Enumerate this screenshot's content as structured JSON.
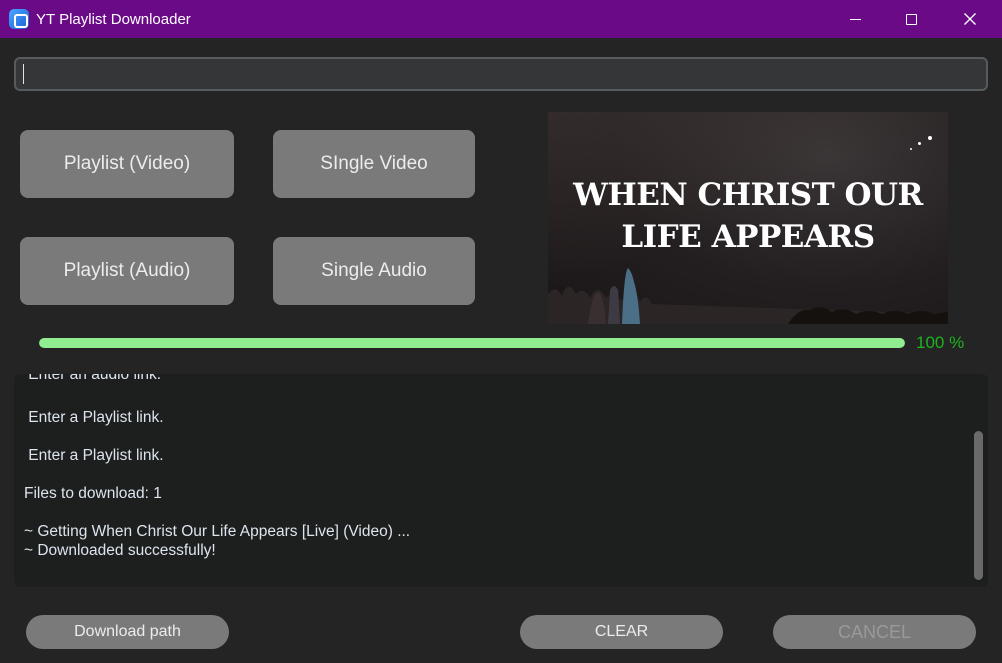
{
  "window": {
    "title": "YT Playlist Downloader",
    "titlebar_color": "#6b0a87"
  },
  "url_input": {
    "value": "",
    "placeholder": ""
  },
  "buttons": {
    "playlist_video": "Playlist (Video)",
    "single_video": "SIngle Video",
    "playlist_audio": "Playlist (Audio)",
    "single_audio": "Single Audio",
    "download_path": "Download path",
    "clear": "CLEAR",
    "cancel": "CANCEL"
  },
  "thumbnail": {
    "title_line1": "WHEN CHRIST OUR",
    "title_line2": "LIFE APPEARS"
  },
  "progress": {
    "value": 1.0,
    "label": "100 %",
    "fill_color": "#90ee90",
    "label_color": "#1db31d"
  },
  "log": {
    "lines": [
      " Enter an audio link.",
      " Enter a Playlist link.",
      " Enter a Playlist link.",
      "Files to download: 1",
      "~ Getting When Christ Our Life Appears [Live] (Video) ...",
      "~ Downloaded successfully!"
    ]
  },
  "icons": {
    "app": "app-icon",
    "minimize": "minimize-icon",
    "maximize": "maximize-icon",
    "close": "close-icon"
  }
}
